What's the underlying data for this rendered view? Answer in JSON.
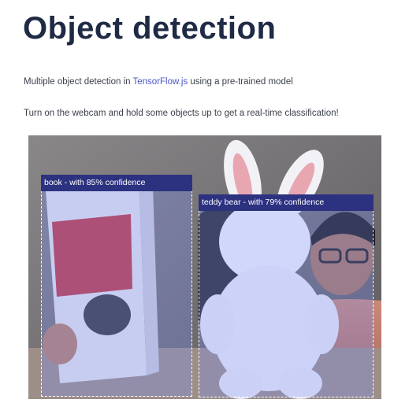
{
  "page": {
    "title": "Object detection",
    "intro_prefix": "Multiple object detection in ",
    "intro_link": "TensorFlow.js",
    "intro_suffix": " using a pre-trained model",
    "instruction": "Turn on the webcam and hold some objects up to get a real-time classification!"
  },
  "detections": [
    {
      "label": "book - with 85% confidence"
    },
    {
      "label": "teddy bear - with 79% confidence"
    }
  ],
  "colors": {
    "label_bg": "#2c3280",
    "highlight": "rgba(120,140,255,0.28)",
    "link": "#4a56c8"
  }
}
